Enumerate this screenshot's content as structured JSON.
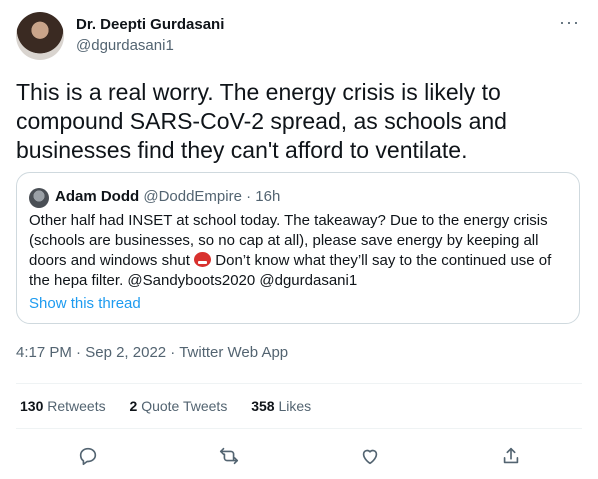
{
  "author": {
    "name": "Dr. Deepti Gurdasani",
    "handle": "@dgurdasani1"
  },
  "more_label": "···",
  "tweet": {
    "text": "This is a real worry. The energy crisis is likely to compound SARS-CoV-2 spread, as schools and businesses find they can't afford to ventilate."
  },
  "quoted": {
    "name": "Adam Dodd",
    "handle": "@DoddEmpire",
    "separator": "·",
    "time": "16h",
    "text_before_emoji": "Other half had INSET at school today. The takeaway? Due to the energy crisis (schools are businesses, so no cap at all), please save energy by keeping all doors and windows shut ",
    "text_after_emoji": " Don’t know what they’ll say to the continued use of the hepa filter.  @Sandyboots2020 @dgurdasani1",
    "emoji_icon": "angry-face-emoji",
    "show_thread": "Show this thread"
  },
  "meta": {
    "time": "4:17 PM",
    "dot1": "·",
    "date": "Sep 2, 2022",
    "dot2": "·",
    "source": "Twitter Web App"
  },
  "stats": {
    "retweets_count": "130",
    "retweets_label": "Retweets",
    "quotes_count": "2",
    "quotes_label": "Quote Tweets",
    "likes_count": "358",
    "likes_label": "Likes"
  },
  "actions": [
    "reply-icon",
    "retweet-icon",
    "like-icon",
    "share-icon"
  ],
  "colors": {
    "text": "#0f1419",
    "secondary": "#536471",
    "link": "#1d9bf0",
    "border": "#cfd9de"
  }
}
